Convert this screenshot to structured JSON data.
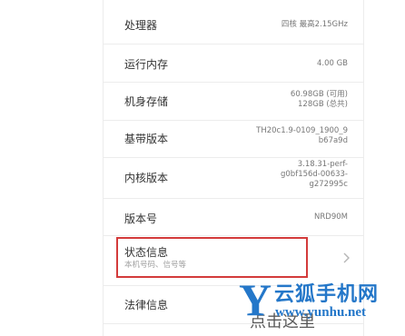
{
  "settings": {
    "rows": [
      {
        "label": "处理器",
        "value": "四核 最高2.15GHz"
      },
      {
        "label": "运行内存",
        "value": "4.00 GB"
      },
      {
        "label": "机身存储",
        "value_lines": [
          "60.98GB (可用)",
          "128GB (总共)"
        ]
      },
      {
        "label": "基带版本",
        "value_lines": [
          "TH20c1.9-0109_1900_9",
          "b67a9d"
        ]
      },
      {
        "label": "内核版本",
        "value_lines": [
          "3.18.31-perf-",
          "g0bf156d-00633-",
          "g272995c"
        ]
      },
      {
        "label": "版本号",
        "value": "NRD90M"
      },
      {
        "label": "状态信息",
        "sublabel": "本机号码、信号等",
        "chevron_icon": "chevron-right-icon"
      },
      {
        "label": "法律信息"
      }
    ]
  },
  "highlight": {
    "color": "#d33b3b"
  },
  "watermark": {
    "logo_letter": "Y",
    "chinese": "云狐手机网",
    "url": "www.yunhu.net",
    "extra": "点击这里",
    "color": "#2477c9"
  }
}
